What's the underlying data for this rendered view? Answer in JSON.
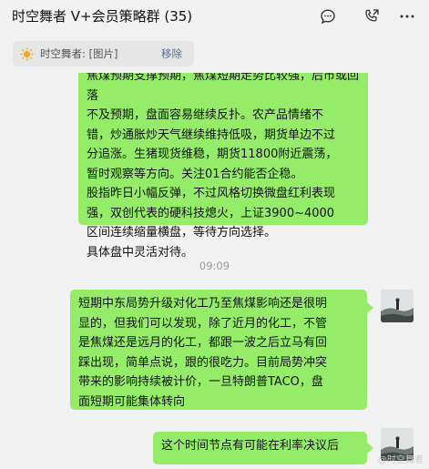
{
  "header": {
    "title": "时空舞者 V+会员策略群 (35)",
    "icons": [
      "chat-bubble-icon",
      "video-call-icon",
      "more-icon"
    ]
  },
  "pinned": {
    "text": "时空舞者: [图片]",
    "action": "移除"
  },
  "messages": [
    {
      "lines": [
        "焦煤预期支撑预期，焦煤短期走势比较强，后市或回落",
        "不及预期，盘面容易继续反扑。农产品情绪不",
        "错，炒通胀炒天气继续维持低吸，期货单边不过",
        "分追涨。生猪现货维稳，期货11800附近震荡，",
        "暂时观察等方向。关注01合约能否企稳。",
        "股指昨日小幅反弹，不过风格切换微盘红利表现",
        "强，双创代表的硬科技熄火，上证3900~4000",
        "区间连续缩量横盘，等待方向选择。",
        "具体盘中灵活对待。"
      ]
    },
    {
      "time": "09:09"
    },
    {
      "lines": [
        "短期中东局势升级对化工乃至焦煤影响还是很明",
        "显的，但我们可以发现，除了近月的化工，不管",
        "是焦煤还是远月的化工，都跟一波之后立马有回",
        "踩出现，简单点说，跟的很吃力。目前局势冲突",
        "带来的影响持续被计价，一旦特朗普TACO，盘",
        "面短期可能集体转向"
      ]
    },
    {
      "lines": [
        "这个时间节点有可能在利率决议后"
      ]
    }
  ],
  "watermark": "@时空舞者",
  "colors": {
    "bubble": "#95ec69",
    "background": "#f2f2f2",
    "link": "#576b95"
  }
}
